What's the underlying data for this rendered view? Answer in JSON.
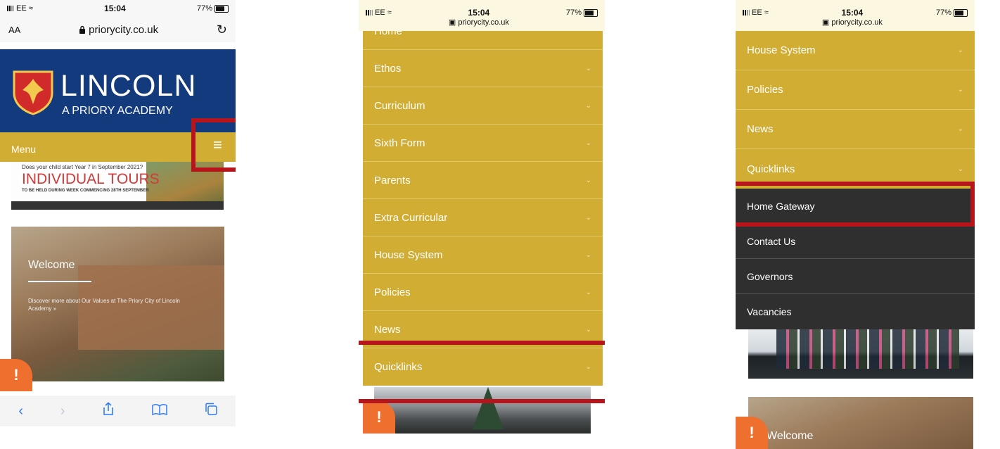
{
  "status": {
    "carrier": "EE",
    "time": "15:04",
    "battery": "77%"
  },
  "browser": {
    "text_size": "AA",
    "domain": "priorycity.co.uk"
  },
  "school": {
    "name": "LINCOLN",
    "subtitle": "A PRIORY ACADEMY"
  },
  "menu_bar": {
    "label": "Menu"
  },
  "banner": {
    "line1": "Does your child start Year 7 in September 2021?",
    "headline": "INDIVIDUAL TOURS",
    "line2": "TO BE HELD DURING WEEK COMMENCING 28TH SEPTEMBER"
  },
  "welcome": {
    "title": "Welcome",
    "text": "Discover more about Our Values at The Priory City of Lincoln Academy",
    "arrows": "»"
  },
  "alert_symbol": "!",
  "screen2": {
    "partial_item": "Home",
    "menu_items": [
      "Ethos",
      "Curriculum",
      "Sixth Form",
      "Parents",
      "Extra Curricular",
      "House System",
      "Policies",
      "News",
      "Quicklinks"
    ]
  },
  "screen3": {
    "menu_items": [
      "House System",
      "Policies",
      "News",
      "Quicklinks"
    ],
    "quicklinks": [
      "Home Gateway",
      "Contact Us",
      "Governors",
      "Vacancies"
    ],
    "welcome_title": "Welcome"
  },
  "icons": {
    "chevron": "⌄",
    "hamburger": "≡",
    "reload": "↻",
    "lock": "lock-icon"
  },
  "colors": {
    "navy": "#133a7c",
    "gold": "#d2ad33",
    "highlight": "#b5151b",
    "dark_menu": "#2f2f2f",
    "alert": "#ef6f2e"
  }
}
